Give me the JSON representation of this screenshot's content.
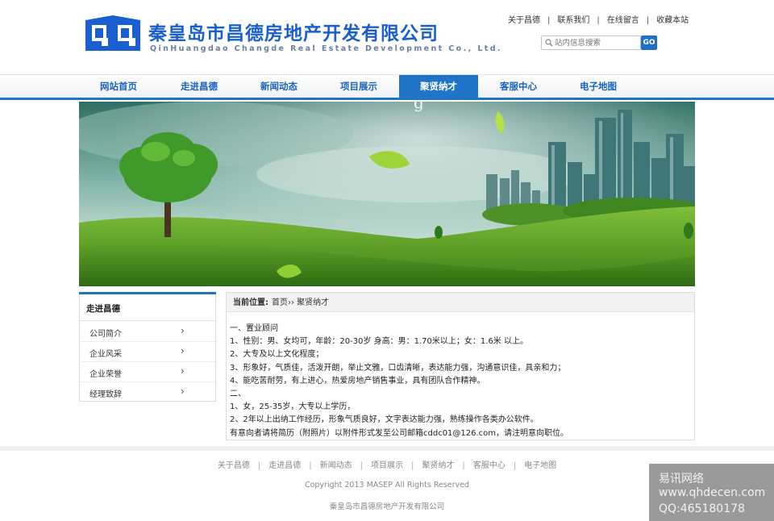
{
  "header": {
    "logo_cn": "秦皇岛市昌德房地产开发有限公司",
    "logo_en": "QinHuangdao Changde Real Estate Development Co., Ltd.",
    "top_links": [
      "关于昌德",
      "联系我们",
      "在线留言",
      "收藏本站"
    ],
    "search_placeholder": "站内信息搜索",
    "search_button": "GO"
  },
  "nav": {
    "items": [
      "网站首页",
      "走进昌德",
      "新闻动态",
      "项目展示",
      "聚贤纳才",
      "客服中心",
      "电子地图"
    ],
    "active_index": 4
  },
  "sidebar": {
    "title": "走进昌德",
    "items": [
      "公司简介",
      "企业风采",
      "企业荣誉",
      "经理致辞"
    ],
    "arrow": "›"
  },
  "content": {
    "breadcrumb_label": "当前位置:",
    "breadcrumb_path": "首页›› 聚贤纳才",
    "lines": [
      "一、置业顾问",
      "1、性别：男、女均可，年龄：20-30岁  身高：男：1.70米以上；女：1.6米  以上。",
      "2、大专及以上文化程度；",
      "3、形象好，气质佳，活泼开朗，举止文雅，口齿清晰，表达能力强，沟通意识佳，具亲和力；",
      "4、能吃苦耐劳，有上进心，热爱房地产销售事业，具有团队合作精神。",
      "二、",
      "1、女，25-35岁，大专以上学历，",
      "2、2年以上出纳工作经历，形象气质良好，文字表达能力强，熟练操作各类办公软件。",
      "有意向者请将简历（附照片）以附件形式发至公司邮箱cddc01@126.com，请注明意向职位。"
    ]
  },
  "footer": {
    "links": [
      "关于昌德",
      "走进昌德",
      "新闻动态",
      "项目展示",
      "聚贤纳才",
      "客服中心",
      "电子地图"
    ],
    "copyright": "Copyright 2013 MASEP All Rights Reserved",
    "company": "秦皇岛市昌德房地产开发有限公司"
  },
  "watermark": {
    "line1": "易讯网络",
    "line2": "www.qhdecen.com",
    "line3": "QQ:465180178"
  },
  "colors": {
    "brand_blue": "#1f74c8",
    "logo_blue": "#1a5fd0"
  }
}
